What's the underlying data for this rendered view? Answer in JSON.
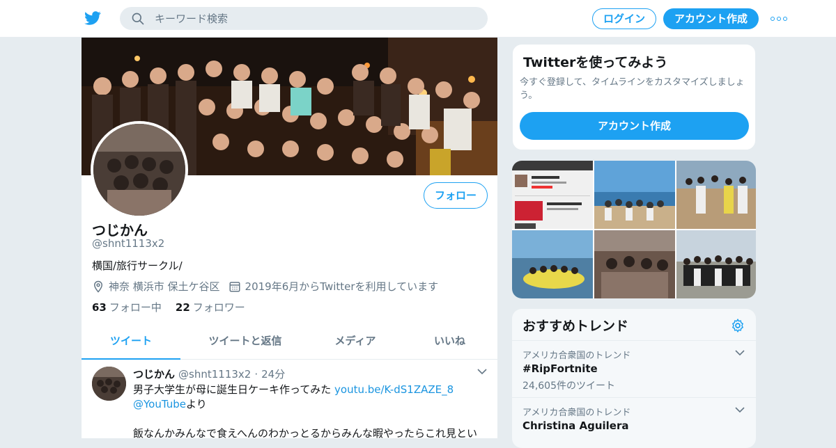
{
  "topbar": {
    "search_placeholder": "キーワード検索",
    "login_label": "ログイン",
    "signup_label": "アカウント作成"
  },
  "profile": {
    "follow_label": "フォロー",
    "name": "つじかん",
    "handle": "@shnt1113x2",
    "bio": "横国/旅行サークル/",
    "location": "神奈 横浜市 保土ケ谷区",
    "joined": "2019年6月からTwitterを利用しています",
    "following_count": "63",
    "following_label": "フォロー中",
    "followers_count": "22",
    "followers_label": "フォロワー"
  },
  "tabs": [
    {
      "label": "ツイート"
    },
    {
      "label": "ツイートと返信"
    },
    {
      "label": "メディア"
    },
    {
      "label": "いいね"
    }
  ],
  "tweet": {
    "name": "つじかん",
    "handle": "@shnt1113x2",
    "dot": "·",
    "time": "24分",
    "text_1": "男子大学生が母に誕生日ケーキ作ってみた ",
    "link_1": "youtu.be/K-dS1ZAZE_8",
    "link_2": "@YouTube",
    "text_2": "より",
    "text_3": "飯なんかみんなで食えへんのわかっとるからみんな暇やったらこれ見とい"
  },
  "signup_card": {
    "title": "Twitterを使ってみよう",
    "desc": "今すぐ登録して、タイムラインをカスタマイズしましょう。",
    "button": "アカウント作成"
  },
  "trends": {
    "title": "おすすめトレンド",
    "items": [
      {
        "context": "アメリカ合衆国のトレンド",
        "name": "#RipFortnite",
        "count": "24,605件のツイート"
      },
      {
        "context": "アメリカ合衆国のトレンド",
        "name": "Christina Aguilera",
        "count": ""
      }
    ]
  },
  "colors": {
    "accent": "#1da1f2",
    "secondary_text": "#657786",
    "background": "#e6ecf0"
  },
  "icons": [
    "twitter-bird-icon",
    "search-icon",
    "more-dots-icon",
    "location-pin-icon",
    "calendar-icon",
    "chevron-down-icon",
    "gear-icon"
  ]
}
